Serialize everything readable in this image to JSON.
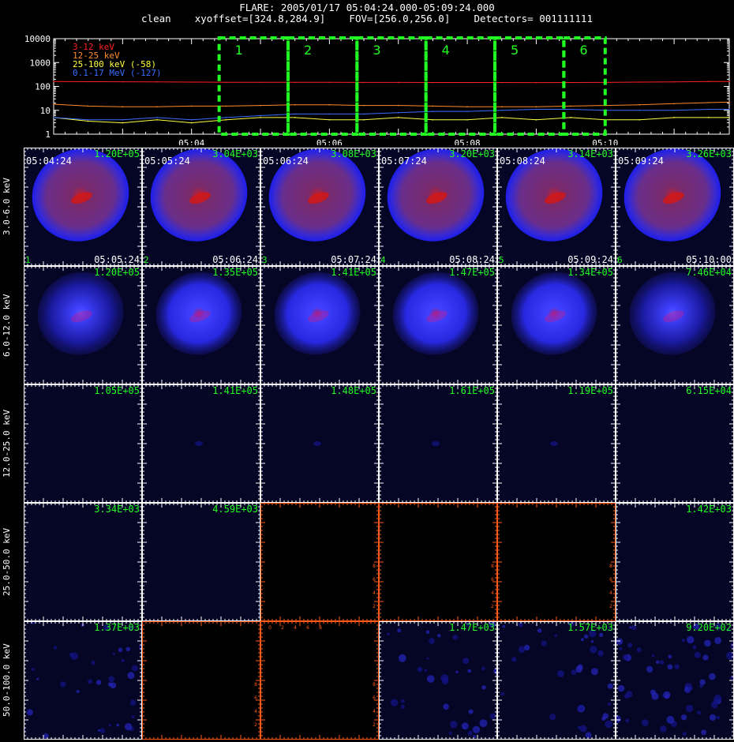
{
  "header": {
    "title": "FLARE: 2005/01/17 05:04:24.000-05:09:24.000",
    "subtitle": "clean    xyoffset=[324.8,284.9]    FOV=[256.0,256.0]    Detectors= 001111111"
  },
  "colors": {
    "red": "#ff2020",
    "orange": "#ff8a2a",
    "yellow": "#ffff40",
    "blue": "#3a6cff",
    "green": "#22ff22",
    "box": "#22ff22",
    "axis_orange": "#ff5a1a",
    "bg_blue": "#050526"
  },
  "lightcurve": {
    "legend": [
      {
        "label": "3-12 keV",
        "color": "#ff2020"
      },
      {
        "label": "12-25 keV",
        "color": "#ff8a2a"
      },
      {
        "label": "25-100 keV (-58)",
        "color": "#ffff40"
      },
      {
        "label": "0.1-17 MeV (-127)",
        "color": "#3a6cff"
      }
    ],
    "ytick_labels": [
      "10000",
      "1000",
      "100",
      "10",
      "1"
    ],
    "xtick_labels": [
      "05:04",
      "05:06",
      "05:08",
      "05:10"
    ],
    "interval_labels": [
      "1",
      "2",
      "3",
      "4",
      "5",
      "6"
    ]
  },
  "chart_data": {
    "type": "line",
    "title": "FLARE: 2005/01/17 05:04:24.000-05:09:24.000",
    "xlabel": "",
    "ylabel": "",
    "yscale": "log",
    "ylim": [
      1,
      10000
    ],
    "xlim": [
      "05:02:00",
      "05:11:48"
    ],
    "x": [
      "05:02:00",
      "05:02:30",
      "05:03:00",
      "05:03:30",
      "05:04:00",
      "05:04:30",
      "05:05:00",
      "05:05:30",
      "05:06:00",
      "05:06:30",
      "05:07:00",
      "05:07:30",
      "05:08:00",
      "05:08:30",
      "05:09:00",
      "05:09:30",
      "05:10:00",
      "05:10:30",
      "05:11:00",
      "05:11:30",
      "05:11:48"
    ],
    "series": [
      {
        "name": "3-12 keV",
        "values": [
          160,
          158,
          157,
          156,
          152,
          150,
          149,
          148,
          148,
          147,
          147,
          146,
          146,
          146,
          145,
          146,
          147,
          152,
          155,
          160,
          162
        ]
      },
      {
        "name": "12-25 keV",
        "values": [
          18,
          15,
          14,
          14,
          15,
          15,
          16,
          17,
          17,
          16,
          16,
          15,
          14,
          14,
          14,
          15,
          16,
          17,
          19,
          21,
          22
        ]
      },
      {
        "name": "25-100 keV (-58)",
        "values": [
          5,
          3.5,
          3,
          4,
          3,
          4,
          5,
          5,
          4,
          4,
          5,
          4,
          4,
          5,
          4,
          5,
          4,
          4,
          5,
          5,
          5
        ]
      },
      {
        "name": "0.1-17 MeV (-127)",
        "values": [
          5,
          4,
          4,
          5,
          4,
          5,
          6,
          7,
          7,
          7,
          8,
          9,
          9,
          10,
          11,
          11,
          10,
          10,
          10,
          11,
          11
        ]
      }
    ],
    "intervals": [
      {
        "label": "1",
        "start": "05:04:24",
        "end": "05:05:24"
      },
      {
        "label": "2",
        "start": "05:05:24",
        "end": "05:06:24"
      },
      {
        "label": "3",
        "start": "05:06:24",
        "end": "05:07:24"
      },
      {
        "label": "4",
        "start": "05:07:24",
        "end": "05:08:24"
      },
      {
        "label": "5",
        "start": "05:08:24",
        "end": "05:09:24"
      },
      {
        "label": "6",
        "start": "05:09:24",
        "end": "05:10:00"
      }
    ]
  },
  "image_grid": {
    "start_times": [
      "05:04:24",
      "05:05:24",
      "05:06:24",
      "05:07:24",
      "05:08:24",
      "05:09:24"
    ],
    "end_times": [
      "05:05:24",
      "05:06:24",
      "05:07:24",
      "05:08:24",
      "05:09:24",
      "05:10:00"
    ],
    "indices": [
      "1",
      "2",
      "3",
      "4",
      "5",
      "6"
    ],
    "empty_tick_labels": [
      "0",
      "2",
      "4",
      "6",
      "8"
    ],
    "rows": [
      {
        "label": "3.0-6.0 keV",
        "style": "bright",
        "peaks": [
          "1.20E+05",
          "3.04E+03",
          "3.08E+03",
          "3.20E+03",
          "3.14E+03",
          "3.26E+03"
        ]
      },
      {
        "label": "6.0-12.0 keV",
        "style": "medium",
        "peaks": [
          "1.20E+05",
          "1.35E+05",
          "1.41E+05",
          "1.47E+05",
          "1.34E+05",
          "7.46E+04"
        ]
      },
      {
        "label": "12.0-25.0 keV",
        "style": "faint",
        "peaks": [
          "1.05E+05",
          "1.41E+05",
          "1.48E+05",
          "1.61E+05",
          "1.19E+05",
          "6.15E+04"
        ]
      },
      {
        "label": "25.0-50.0 keV",
        "style": "dark",
        "peaks": [
          "3.34E+03",
          "4.59E+03",
          "",
          "",
          "",
          "1.42E+03"
        ],
        "empty": [
          false,
          false,
          true,
          true,
          true,
          false
        ]
      },
      {
        "label": "50.0-100.0 keV",
        "style": "noise",
        "peaks": [
          "1.37E+03",
          "",
          "",
          "1.47E+03",
          "1.57E+03",
          "9.20E+02"
        ],
        "empty": [
          false,
          true,
          true,
          false,
          false,
          false
        ]
      }
    ]
  }
}
